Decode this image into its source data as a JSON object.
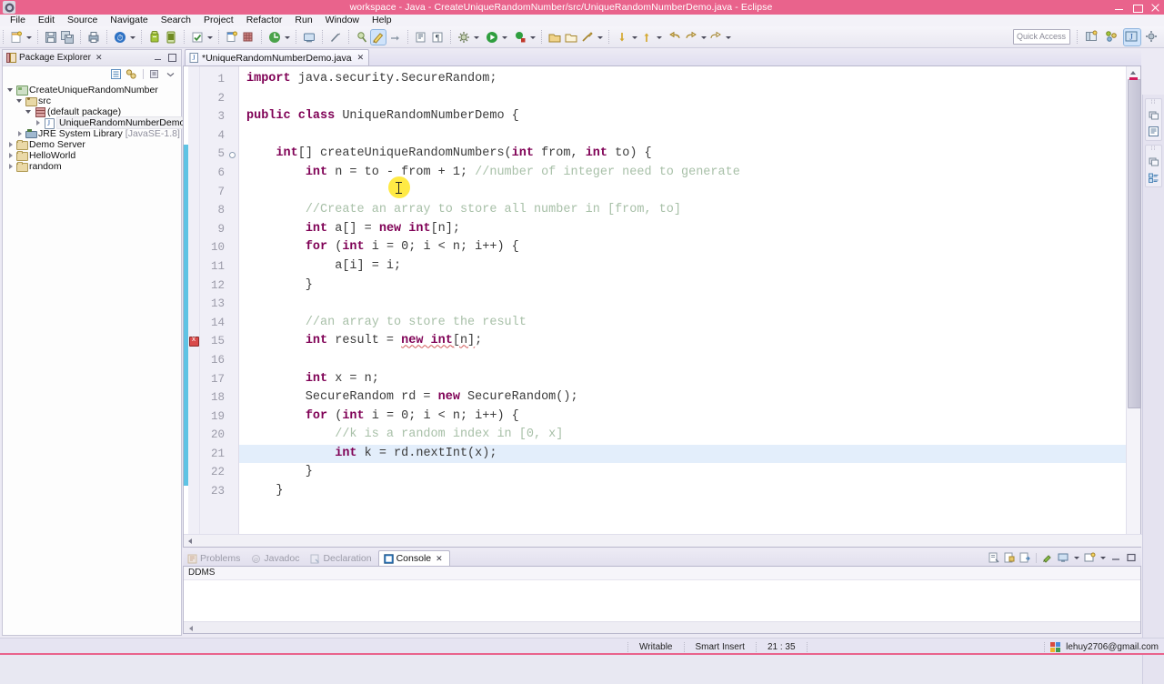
{
  "window": {
    "title": "workspace - Java - CreateUniqueRandomNumber/src/UniqueRandomNumberDemo.java - Eclipse",
    "app_icon": "eclipse-icon",
    "minimize_label": "Minimize",
    "maximize_label": "Maximize",
    "close_label": "Close",
    "title_bar_color": "#e9638c"
  },
  "menu": {
    "items": [
      "File",
      "Edit",
      "Source",
      "Navigate",
      "Search",
      "Project",
      "Refactor",
      "Run",
      "Window",
      "Help"
    ]
  },
  "toolbar": {
    "quick_access_placeholder": "Quick Access",
    "icons": [
      "new-wizard-icon",
      "save-icon",
      "save-all-icon",
      "print-icon",
      "debug-icon",
      "manage-configurations-icon",
      "android-sdk-manager-icon",
      "android-virtual-device-manager-icon",
      "check-icon",
      "new-java-project-icon",
      "new-package-icon",
      "new-class-icon",
      "open-console-icon",
      "skip-breakpoints-icon",
      "toggle-mark-occurrences-icon",
      "toggle-ant-build-icon",
      "link-icon",
      "show-whitespace-icon",
      "show-print-margin-icon",
      "external-tools-icon",
      "run-icon",
      "coverage-icon",
      "open-type-icon",
      "open-task-icon",
      "search-icon",
      "next-annotation-icon",
      "previous-annotation-icon",
      "back-icon",
      "forward-icon",
      "next-edit-icon"
    ],
    "perspective_icons": [
      "open-perspective-icon",
      "ddms-perspective-icon",
      "java-perspective-icon",
      "debug-perspective-icon"
    ]
  },
  "package_explorer": {
    "title": "Package Explorer",
    "close_label": "✕",
    "toolbar_icons": [
      "collapse-all-icon",
      "link-with-editor-icon",
      "view-menu-icon",
      "minimize-view-icon"
    ],
    "tree": [
      {
        "label": "CreateUniqueRandomNumber",
        "icon": "java-project-icon",
        "indent": 0,
        "state": "open",
        "selected": false
      },
      {
        "label": "src",
        "icon": "source-folder-icon",
        "indent": 1,
        "state": "open",
        "selected": false
      },
      {
        "label": "(default package)",
        "icon": "package-icon",
        "indent": 2,
        "state": "open",
        "selected": false
      },
      {
        "label": "UniqueRandomNumberDemo.java",
        "icon": "java-file-icon",
        "indent": 3,
        "state": "closed",
        "selected": true
      },
      {
        "label": "JRE System Library",
        "sub": "[JavaSE-1.8]",
        "icon": "jre-library-icon",
        "indent": 1,
        "state": "closed",
        "selected": false
      },
      {
        "label": "Demo Server",
        "icon": "project-icon",
        "indent": 0,
        "state": "closed",
        "selected": false
      },
      {
        "label": "HelloWorld",
        "icon": "project-icon",
        "indent": 0,
        "state": "closed",
        "selected": false
      },
      {
        "label": "random",
        "icon": "project-icon",
        "indent": 0,
        "state": "closed",
        "selected": false
      }
    ]
  },
  "editor": {
    "tab_label": "*UniqueRandomNumberDemo.java",
    "tab_icon": "java-file-icon",
    "tab_close": "✕",
    "current_line": 21,
    "error_line": 15,
    "change_bar_lines": [
      5,
      22
    ],
    "lines": [
      {
        "n": 1,
        "tokens": [
          {
            "t": "import ",
            "c": "kw"
          },
          {
            "t": "java.security.SecureRandom;",
            "c": "plain"
          }
        ]
      },
      {
        "n": 2,
        "tokens": []
      },
      {
        "n": 3,
        "tokens": [
          {
            "t": "public class ",
            "c": "kw"
          },
          {
            "t": "UniqueRandomNumberDemo {",
            "c": "plain"
          }
        ]
      },
      {
        "n": 4,
        "tokens": []
      },
      {
        "n": 5,
        "tokens": [
          {
            "t": "    ",
            "c": "plain"
          },
          {
            "t": "int",
            "c": "kw"
          },
          {
            "t": "[] createUniqueRandomNumbers(",
            "c": "plain"
          },
          {
            "t": "int",
            "c": "kw"
          },
          {
            "t": " from, ",
            "c": "plain"
          },
          {
            "t": "int",
            "c": "kw"
          },
          {
            "t": " to) {",
            "c": "plain"
          }
        ],
        "fold": true
      },
      {
        "n": 6,
        "tokens": [
          {
            "t": "        ",
            "c": "plain"
          },
          {
            "t": "int",
            "c": "kw"
          },
          {
            "t": " n = to - from + 1; ",
            "c": "plain"
          },
          {
            "t": "//number of integer need to generate",
            "c": "cmt"
          }
        ]
      },
      {
        "n": 7,
        "tokens": []
      },
      {
        "n": 8,
        "tokens": [
          {
            "t": "        ",
            "c": "plain"
          },
          {
            "t": "//Create an array to store all number in [from, to]",
            "c": "cmt"
          }
        ]
      },
      {
        "n": 9,
        "tokens": [
          {
            "t": "        ",
            "c": "plain"
          },
          {
            "t": "int",
            "c": "kw"
          },
          {
            "t": " a[] = ",
            "c": "plain"
          },
          {
            "t": "new int",
            "c": "kw"
          },
          {
            "t": "[n];",
            "c": "plain"
          }
        ]
      },
      {
        "n": 10,
        "tokens": [
          {
            "t": "        ",
            "c": "plain"
          },
          {
            "t": "for",
            "c": "kw"
          },
          {
            "t": " (",
            "c": "plain"
          },
          {
            "t": "int",
            "c": "kw"
          },
          {
            "t": " i = 0; i < n; i++) {",
            "c": "plain"
          }
        ]
      },
      {
        "n": 11,
        "tokens": [
          {
            "t": "            a[i] = i;",
            "c": "plain"
          }
        ]
      },
      {
        "n": 12,
        "tokens": [
          {
            "t": "        }",
            "c": "plain"
          }
        ]
      },
      {
        "n": 13,
        "tokens": []
      },
      {
        "n": 14,
        "tokens": [
          {
            "t": "        ",
            "c": "plain"
          },
          {
            "t": "//an array to store the result",
            "c": "cmt"
          }
        ]
      },
      {
        "n": 15,
        "tokens": [
          {
            "t": "        ",
            "c": "plain"
          },
          {
            "t": "int",
            "c": "kw"
          },
          {
            "t": " result = ",
            "c": "plain"
          },
          {
            "t": "new int",
            "c": "kw err"
          },
          {
            "t": "[n]",
            "c": "plain err"
          },
          {
            "t": ";",
            "c": "plain"
          }
        ]
      },
      {
        "n": 16,
        "tokens": []
      },
      {
        "n": 17,
        "tokens": [
          {
            "t": "        ",
            "c": "plain"
          },
          {
            "t": "int",
            "c": "kw"
          },
          {
            "t": " x = n;",
            "c": "plain"
          }
        ]
      },
      {
        "n": 18,
        "tokens": [
          {
            "t": "        SecureRandom rd = ",
            "c": "plain"
          },
          {
            "t": "new",
            "c": "kw"
          },
          {
            "t": " SecureRandom();",
            "c": "plain"
          }
        ]
      },
      {
        "n": 19,
        "tokens": [
          {
            "t": "        ",
            "c": "plain"
          },
          {
            "t": "for",
            "c": "kw"
          },
          {
            "t": " (",
            "c": "plain"
          },
          {
            "t": "int",
            "c": "kw"
          },
          {
            "t": " i = 0; i < n; i++) {",
            "c": "plain"
          }
        ]
      },
      {
        "n": 20,
        "tokens": [
          {
            "t": "            ",
            "c": "plain"
          },
          {
            "t": "//k is a random index in [0, x]",
            "c": "cmt"
          }
        ]
      },
      {
        "n": 21,
        "tokens": [
          {
            "t": "            ",
            "c": "plain"
          },
          {
            "t": "int",
            "c": "kw"
          },
          {
            "t": " k = rd.nextInt(x);",
            "c": "plain"
          }
        ]
      },
      {
        "n": 22,
        "tokens": [
          {
            "t": "        }",
            "c": "plain"
          }
        ]
      },
      {
        "n": 23,
        "tokens": [
          {
            "t": "    }",
            "c": "plain"
          }
        ]
      }
    ],
    "colors": {
      "keyword": "#7f0055",
      "comment": "#a8c0a8",
      "plain": "#3b3b3b",
      "current_line_bg": "#e3eefb",
      "change_bar": "#5fc3e4"
    }
  },
  "console_panel": {
    "tabs": [
      {
        "label": "Problems",
        "icon": "problems-icon",
        "active": false
      },
      {
        "label": "Javadoc",
        "icon": "javadoc-icon",
        "active": false
      },
      {
        "label": "Declaration",
        "icon": "declaration-icon",
        "active": false
      },
      {
        "label": "Console",
        "icon": "console-icon",
        "active": true
      }
    ],
    "tab_close": "✕",
    "content_label": "DDMS",
    "toolbar_icons": [
      "clear-console-icon",
      "lock-scroll-icon",
      "show-console-on-output-icon",
      "pin-console-icon",
      "display-selected-console-icon",
      "open-console-icon",
      "minimize-icon",
      "maximize-icon"
    ]
  },
  "fast_view_bar": {
    "groups": [
      {
        "dots": "⋯",
        "icons": [
          "restore-icon",
          "console-view-icon"
        ]
      },
      {
        "dots": "⋯",
        "icons": [
          "restore-icon",
          "outline-view-icon"
        ]
      }
    ]
  },
  "status_bar": {
    "writable": "Writable",
    "insert_mode": "Smart Insert",
    "cursor_position": "21 : 35",
    "account": "lehuy2706@gmail.com",
    "account_icon": "google-account-icon"
  }
}
